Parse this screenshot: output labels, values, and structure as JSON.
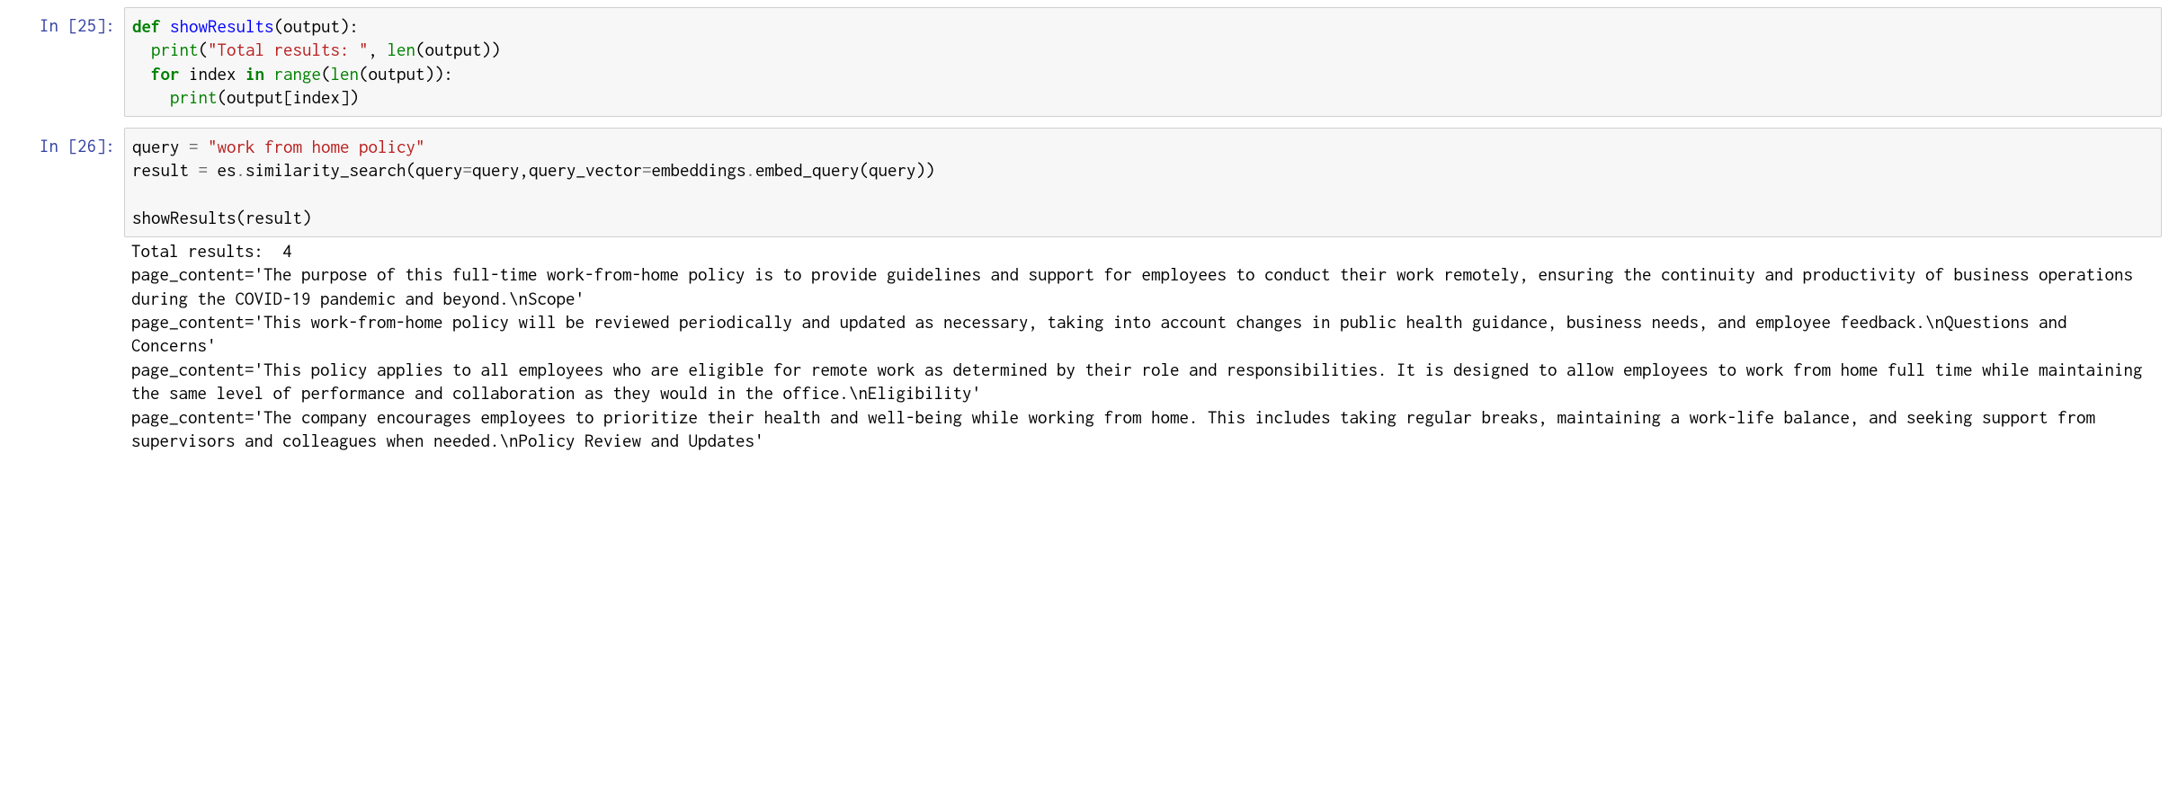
{
  "cell1": {
    "prompt_label": "In [",
    "prompt_num": "25",
    "prompt_close": "]:",
    "tokens": {
      "def": "def",
      "funcname": "showResults",
      "paren_open": "(",
      "arg": "output",
      "paren_close": ")",
      "colon": ":",
      "print1": "print",
      "str1": "\"Total results: \"",
      "comma": ", ",
      "len": "len",
      "output1": "output",
      "for": "for",
      "index": "index",
      "in": "in",
      "range": "range",
      "len2": "len",
      "output2": "output",
      "print2": "print",
      "output3": "output",
      "bracket_open": "[",
      "index2": "index",
      "bracket_close": "]"
    }
  },
  "cell2": {
    "prompt_label": "In [",
    "prompt_num": "26",
    "prompt_close": "]:",
    "tokens": {
      "query_var": "query",
      "eq": " = ",
      "query_str": "\"work from home policy\"",
      "result_var": "result",
      "es": "es",
      "dot": ".",
      "simsearch": "similarity_search",
      "kw_query": "query",
      "kw_query_vector": "query_vector",
      "embeddings": "embeddings",
      "embed_query": "embed_query",
      "showResults": "showResults",
      "result2": "result"
    }
  },
  "output": {
    "line1": "Total results:  4",
    "line2": "page_content='The purpose of this full-time work-from-home policy is to provide guidelines and support for employees to conduct their work remotely, ensuring the continuity and productivity of business operations during the COVID-19 pandemic and beyond.\\nScope'",
    "line3": "page_content='This work-from-home policy will be reviewed periodically and updated as necessary, taking into account changes in public health guidance, business needs, and employee feedback.\\nQuestions and Concerns'",
    "line4": "page_content='This policy applies to all employees who are eligible for remote work as determined by their role and responsibilities. It is designed to allow employees to work from home full time while maintaining the same level of performance and collaboration as they would in the office.\\nEligibility'",
    "line5": "page_content='The company encourages employees to prioritize their health and well-being while working from home. This includes taking regular breaks, maintaining a work-life balance, and seeking support from supervisors and colleagues when needed.\\nPolicy Review and Updates'"
  }
}
